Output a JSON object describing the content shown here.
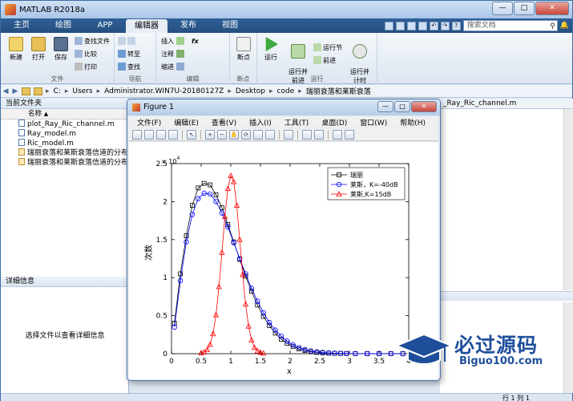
{
  "window": {
    "title": "MATLAB R2018a"
  },
  "tabs": [
    {
      "label": "主页"
    },
    {
      "label": "绘图"
    },
    {
      "label": "APP"
    },
    {
      "label": "编辑器"
    },
    {
      "label": "发布"
    },
    {
      "label": "视图"
    }
  ],
  "search": {
    "placeholder": "搜索文档"
  },
  "ribbon": {
    "file": {
      "label": "文件",
      "new": "新建",
      "open": "打开",
      "save": "保存",
      "find_files": "查找文件",
      "compare": "比较",
      "print": "打印"
    },
    "navigate": {
      "label": "导航",
      "goto": "转至",
      "find": "查找"
    },
    "edit": {
      "label": "编辑",
      "insert": "插入",
      "fx": "fx",
      "comment": "注释",
      "indent": "缩进"
    },
    "breakpoints": {
      "label": "断点",
      "breakpoint": "断点"
    },
    "run": {
      "label": "运行",
      "run": "运行",
      "run_advance": "运行并\n前进",
      "run_section": "运行节",
      "advance": "前进",
      "run_time": "运行并\n计时"
    }
  },
  "address": {
    "drive": "C:",
    "parts": [
      "Users",
      "Administrator.WIN7U-20180127Z",
      "Desktop",
      "code",
      "瑞丽衰落和莱斯衰落"
    ]
  },
  "left_panel": {
    "title": "当前文件夹",
    "column": "名称",
    "files": [
      {
        "name": "plot_Ray_Ric_channel.m",
        "type": "m"
      },
      {
        "name": "Ray_model.m",
        "type": "m"
      },
      {
        "name": "Ric_model.m",
        "type": "m"
      },
      {
        "name": "瑞丽衰落和莱斯衰落信道的分布.emf",
        "type": "fig"
      },
      {
        "name": "瑞丽衰落和莱斯衰落信道的分布.fig",
        "type": "fig"
      }
    ],
    "detail_title": "详细信息",
    "detail_msg": "选择文件以查看详细信息"
  },
  "editor_tab": {
    "label": "_Ray_Ric_channel.m"
  },
  "status": {
    "pos": "行 1     列 1"
  },
  "figure": {
    "title": "Figure 1",
    "menu": [
      "文件(F)",
      "编辑(E)",
      "查看(V)",
      "插入(I)",
      "工具(T)",
      "桌面(D)",
      "窗口(W)",
      "帮助(H)"
    ]
  },
  "chart_data": {
    "type": "line",
    "xlabel": "x",
    "ylabel": "次数",
    "xlim": [
      0,
      4
    ],
    "ylim": [
      0,
      25000
    ],
    "xticks": [
      "0",
      "0.5",
      "1",
      "1.5",
      "2",
      "2.5",
      "3",
      "3.5",
      "4"
    ],
    "yticks": [
      "0",
      "0.5",
      "1",
      "1.5",
      "2",
      "2.5"
    ],
    "exponent": "× 10^4",
    "exp_base": "× 10",
    "exp_power": "4",
    "legend_position": "top-right",
    "series": [
      {
        "name": "瑞丽",
        "color": "#000000",
        "marker": "square",
        "x": [
          0.05,
          0.15,
          0.25,
          0.35,
          0.45,
          0.55,
          0.65,
          0.75,
          0.85,
          0.95,
          1.05,
          1.15,
          1.25,
          1.35,
          1.45,
          1.55,
          1.65,
          1.75,
          1.85,
          1.95,
          2.05,
          2.15,
          2.25,
          2.35,
          2.45,
          2.55,
          2.65,
          2.75,
          2.85,
          2.95,
          3.1,
          3.3,
          3.5,
          3.7,
          3.9
        ],
        "y": [
          4000,
          10500,
          15500,
          19500,
          21800,
          22400,
          22200,
          20900,
          19200,
          17000,
          14700,
          12400,
          10200,
          8200,
          6400,
          4900,
          3700,
          2700,
          1900,
          1350,
          930,
          620,
          410,
          270,
          170,
          110,
          70,
          45,
          30,
          20,
          10,
          5,
          3,
          2,
          1
        ]
      },
      {
        "name": "莱斯，K=-40dB",
        "color": "#0000ff",
        "marker": "circle",
        "x": [
          0.05,
          0.15,
          0.25,
          0.35,
          0.45,
          0.55,
          0.65,
          0.75,
          0.85,
          0.95,
          1.05,
          1.15,
          1.25,
          1.35,
          1.45,
          1.55,
          1.65,
          1.75,
          1.85,
          1.95,
          2.05,
          2.15,
          2.25,
          2.35,
          2.45,
          2.55,
          2.65,
          2.75,
          2.85,
          2.95,
          3.1,
          3.3,
          3.5,
          3.7,
          3.9
        ],
        "y": [
          3500,
          9600,
          14700,
          18300,
          20400,
          21100,
          21000,
          20000,
          18500,
          16700,
          14600,
          12500,
          10500,
          8600,
          6900,
          5400,
          4100,
          3100,
          2300,
          1650,
          1150,
          800,
          540,
          360,
          240,
          160,
          100,
          65,
          40,
          25,
          14,
          7,
          4,
          2,
          1
        ]
      },
      {
        "name": "莱斯,K=15dB",
        "color": "#ff0000",
        "marker": "triangle",
        "x": [
          0.5,
          0.55,
          0.6,
          0.65,
          0.7,
          0.75,
          0.8,
          0.85,
          0.9,
          0.95,
          1.0,
          1.05,
          1.1,
          1.15,
          1.2,
          1.25,
          1.3,
          1.35,
          1.4,
          1.45,
          1.5,
          1.55
        ],
        "y": [
          100,
          200,
          500,
          1200,
          2600,
          5100,
          8800,
          13300,
          18000,
          21700,
          23400,
          22600,
          19500,
          15000,
          10400,
          6500,
          3600,
          1800,
          800,
          350,
          150,
          60
        ]
      }
    ]
  },
  "watermark": {
    "cn": "必过源码",
    "en": "Biguo100.com"
  }
}
